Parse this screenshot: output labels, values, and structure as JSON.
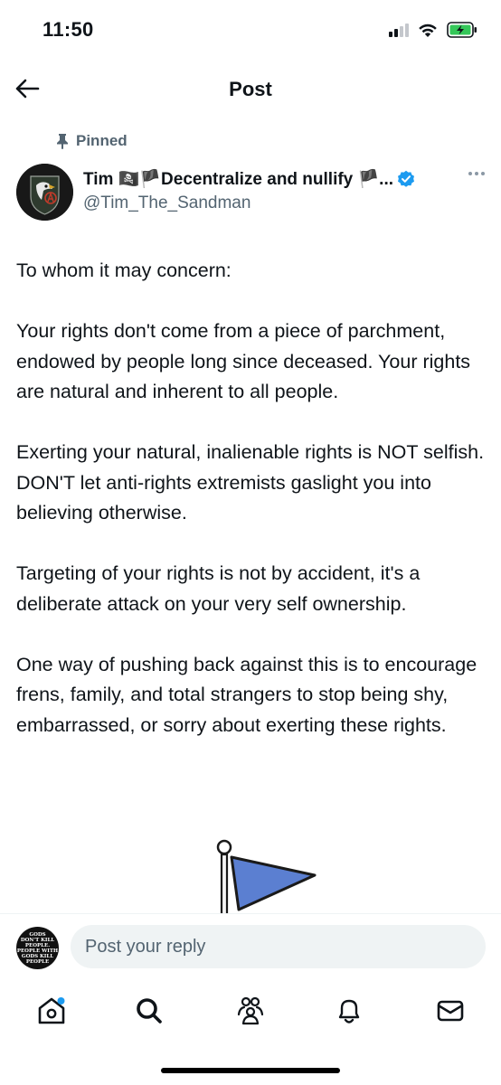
{
  "status_bar": {
    "time": "11:50"
  },
  "header": {
    "title": "Post",
    "back_icon": "arrow-left-icon"
  },
  "pinned": {
    "label": "Pinned",
    "icon": "pin-icon"
  },
  "author": {
    "name": "Tim 🏴‍☠️🏴Decentralize and nullify 🏴...",
    "handle": "@Tim_The_Sandman",
    "verified": true,
    "verified_color": "#1d9bf0"
  },
  "post": {
    "paragraphs": [
      "To whom it may concern:",
      "Your rights don't come from a piece of parchment, endowed by people long since deceased.  Your rights are natural and inherent to all people.",
      "Exerting your natural, inalienable rights is NOT selfish.  DON'T let anti-rights extremists gaslight you into believing otherwise.",
      "Targeting of your rights is not by accident, it's a deliberate attack on your very self ownership.",
      "One way of pushing back against this is to encourage frens, family, and total strangers to stop being shy, embarrassed, or sorry about exerting these rights."
    ]
  },
  "reply": {
    "placeholder": "Post your reply",
    "avatar_text": [
      "GODS",
      "DON'T KILL",
      "PEOPLE.",
      "PEOPLE WITH",
      "GODS KILL",
      "PEOPLE"
    ]
  },
  "nav": {
    "items": [
      "home-icon",
      "search-icon",
      "communities-icon",
      "notifications-icon",
      "messages-icon"
    ],
    "notification_dot_color": "#1d9bf0"
  }
}
